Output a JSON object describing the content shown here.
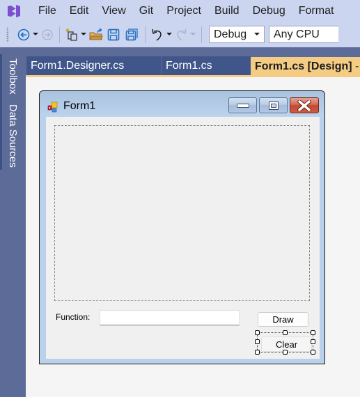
{
  "menubar": {
    "logo": "visual-studio-logo",
    "items": [
      "File",
      "Edit",
      "View",
      "Git",
      "Project",
      "Build",
      "Debug",
      "Format"
    ]
  },
  "toolbar": {
    "icons": [
      "navigate-back-icon",
      "navigate-forward-icon",
      "new-project-icon",
      "open-file-icon",
      "save-icon",
      "save-all-icon",
      "undo-icon",
      "redo-icon"
    ],
    "configuration": "Debug",
    "platform": "Any CPU"
  },
  "toolwindows": {
    "toolbox": "Toolbox",
    "data_sources": "Data Sources"
  },
  "tabs": [
    {
      "label": "Form1.Designer.cs",
      "active": false
    },
    {
      "label": "Form1.cs",
      "active": false
    },
    {
      "label": "Form1.cs [Design]",
      "active": true
    }
  ],
  "form": {
    "title": "Form1",
    "function_label": "Function:",
    "function_value": "",
    "draw_label": "Draw",
    "clear_label": "Clear"
  },
  "colors": {
    "chrome": "#ccd5f0",
    "toolwindow": "#5d6b99",
    "tab": "#40568a",
    "active_tab": "#f5cc84",
    "form_frame": "#b9d1ea"
  }
}
